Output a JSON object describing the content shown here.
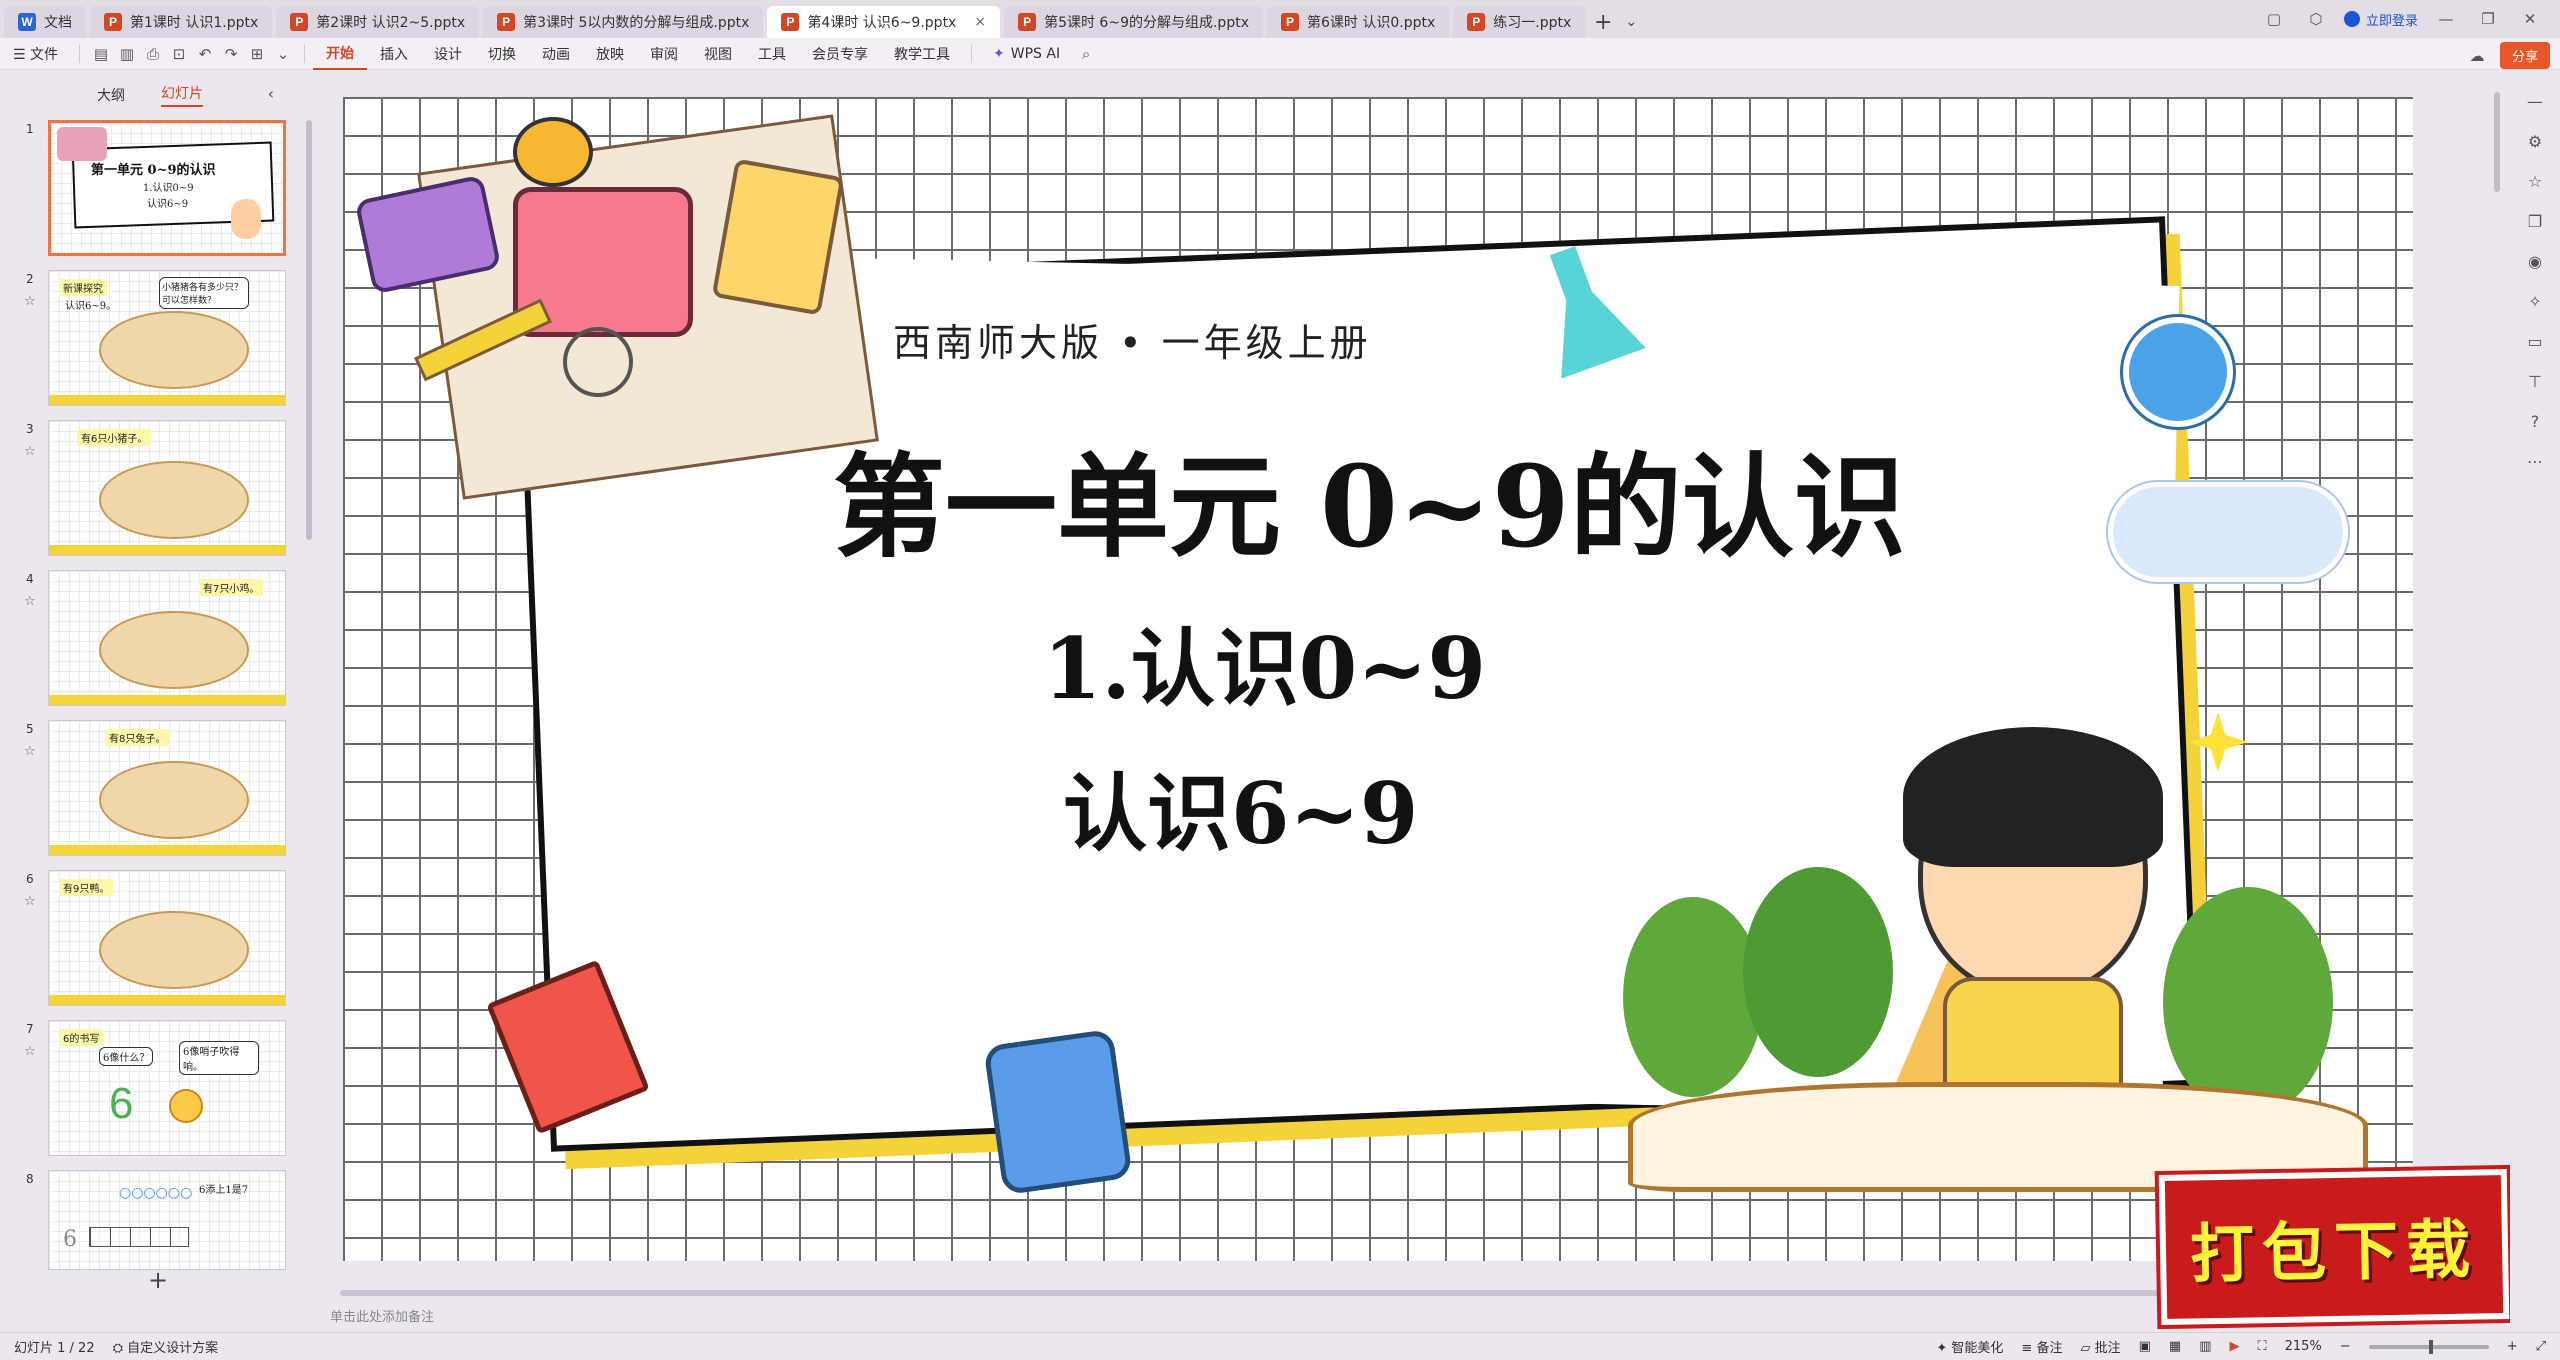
{
  "tabs": [
    {
      "label": "文档",
      "type": "w",
      "active": false
    },
    {
      "label": "第1课时 认识1.pptx",
      "type": "p",
      "active": false
    },
    {
      "label": "第2课时 认识2~5.pptx",
      "type": "p",
      "active": false
    },
    {
      "label": "第3课时 5以内数的分解与组成.pptx",
      "type": "p",
      "active": false
    },
    {
      "label": "第4课时 认识6~9.pptx",
      "type": "p",
      "active": true
    },
    {
      "label": "第5课时 6~9的分解与组成.pptx",
      "type": "p",
      "active": false
    },
    {
      "label": "第6课时 认识0.pptx",
      "type": "p",
      "active": false
    },
    {
      "label": "练习一.pptx",
      "type": "p",
      "active": false
    }
  ],
  "titlebar": {
    "login": "立即登录",
    "new_tab": "+",
    "tab_list": "⌄",
    "close_tab": "×"
  },
  "menu": {
    "file": "☰ 文件",
    "items": [
      "开始",
      "插入",
      "设计",
      "切换",
      "动画",
      "放映",
      "审阅",
      "视图",
      "工具",
      "会员专享",
      "教学工具"
    ],
    "wps_ai": "WPS AI",
    "share": "分享"
  },
  "leftpanel": {
    "tab_outline": "大纲",
    "tab_slides": "幻灯片",
    "collapse": "‹",
    "add": "+",
    "thumbs": [
      {
        "num": "1",
        "title": "第一单元 0~9的认识",
        "sub1": "1.认识0~9",
        "sub2": "认识6~9"
      },
      {
        "num": "2",
        "caption": "新课探究",
        "note": "认识6~9。",
        "bubble": "小猪猪各有多少只？可以怎样数？"
      },
      {
        "num": "3",
        "caption": "有6只小猪子。"
      },
      {
        "num": "4",
        "caption": "有7只小鸡。"
      },
      {
        "num": "5",
        "caption": "有8只兔子。"
      },
      {
        "num": "6",
        "caption": "有9只鸭。"
      },
      {
        "num": "7",
        "caption": "6的书写",
        "bubble1": "6像什么？",
        "bubble2": "6像哨子吹得响。",
        "digit": "6"
      },
      {
        "num": "8",
        "caption": "6添上1是7",
        "digit": "6"
      }
    ]
  },
  "slide": {
    "publisher": "西南师大版 • 一年级上册",
    "title": "第一单元 0~9的认识",
    "subtitle1": "1.认识0~9",
    "subtitle2": "认识6~9",
    "download": "打包下载"
  },
  "notes_placeholder": "单击此处添加备注",
  "status": {
    "slide_counter": "幻灯片 1 / 22",
    "design": "自定义设计方案",
    "beautify": "智能美化",
    "notes": "备注",
    "comments": "批注",
    "zoom": "215%"
  },
  "colors": {
    "accent": "#d24726",
    "share": "#e8572a",
    "yellow": "#f5d13a",
    "badge_red": "#c91b1b"
  }
}
